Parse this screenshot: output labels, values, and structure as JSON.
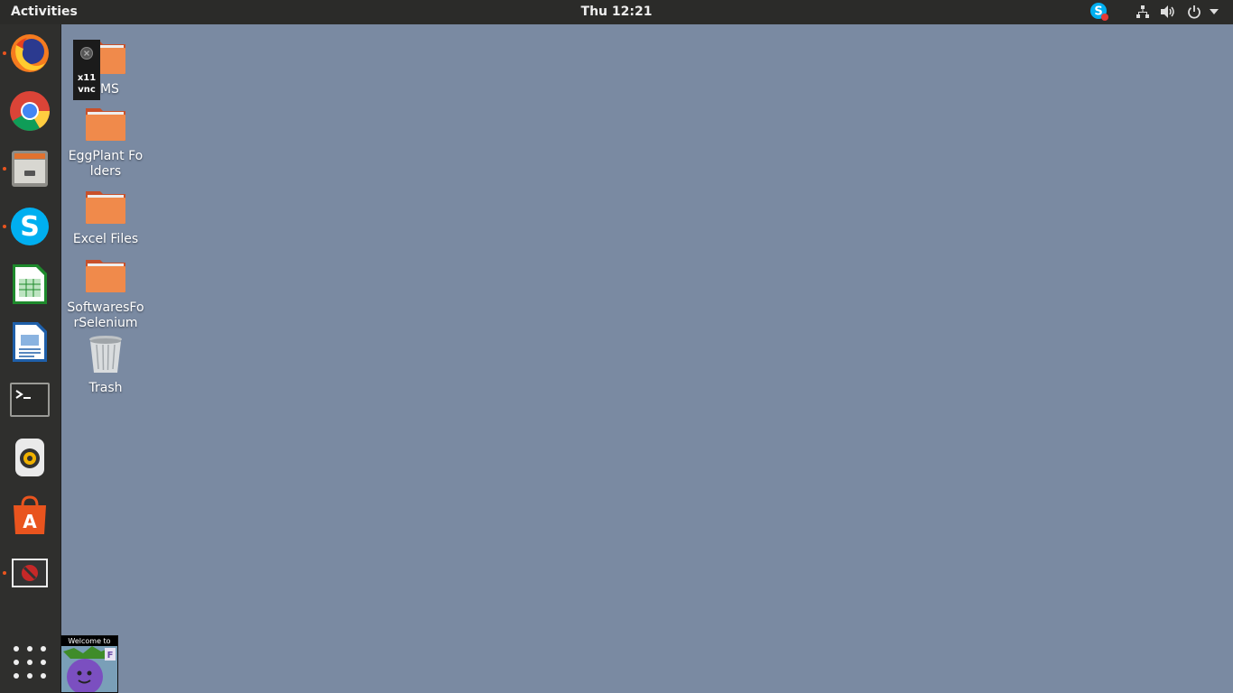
{
  "topbar": {
    "activities": "Activities",
    "clock": "Thu 12:21",
    "tray_icons": [
      "skype-icon",
      "network-icon",
      "volume-icon",
      "power-icon",
      "chevron-down-icon"
    ]
  },
  "dock": {
    "items": [
      {
        "name": "firefox",
        "running": true
      },
      {
        "name": "chrome",
        "running": false
      },
      {
        "name": "files",
        "running": true
      },
      {
        "name": "skype",
        "running": true
      },
      {
        "name": "libreoffice-calc",
        "running": false
      },
      {
        "name": "libreoffice-writer",
        "running": false
      },
      {
        "name": "terminal",
        "running": false
      },
      {
        "name": "rhythmbox",
        "running": false
      },
      {
        "name": "ubuntu-software",
        "running": false
      },
      {
        "name": "vnc-viewer",
        "running": true
      }
    ],
    "show_apps_icon": "apps-grid-icon"
  },
  "desktop": {
    "icons": [
      {
        "label": "SMS",
        "type": "folder"
      },
      {
        "label": "EggPlant Folders",
        "type": "folder"
      },
      {
        "label": "Excel Files",
        "type": "folder"
      },
      {
        "label": "SoftwaresForSelenium",
        "type": "folder"
      },
      {
        "label": "Trash",
        "type": "trash"
      }
    ]
  },
  "vnc_overlay": {
    "line1": "x11",
    "line2": "vnc"
  },
  "welcome": {
    "banner": "Welcome to"
  },
  "colors": {
    "desktop_bg": "#7a8aa2",
    "panel_bg": "#2b2b29",
    "dock_bg": "#2f2f2d",
    "accent": "#e9541e"
  }
}
